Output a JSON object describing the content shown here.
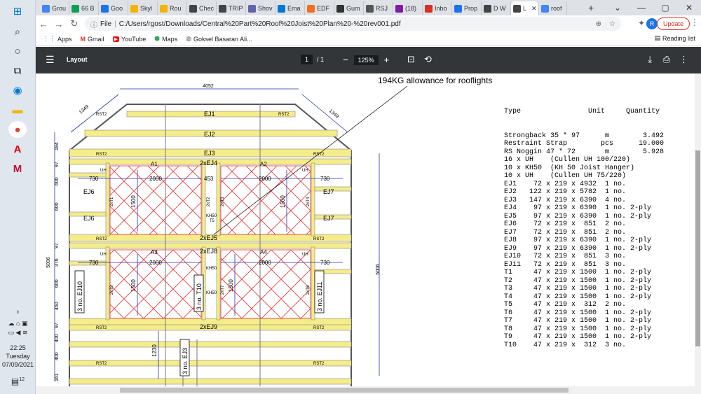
{
  "taskbar": {
    "time": "22:25",
    "day": "Tuesday",
    "date": "07/09/2021",
    "notification_count": "12"
  },
  "tabs": [
    {
      "label": "Grou",
      "color": "#4285f4"
    },
    {
      "label": "66 B",
      "color": "#0f9d58"
    },
    {
      "label": "Goo",
      "color": "#1a73e8"
    },
    {
      "label": "Skyl",
      "color": "#f4b400"
    },
    {
      "label": "Rou",
      "color": "#f4b400"
    },
    {
      "label": "Chec",
      "color": "#444"
    },
    {
      "label": "TRIP",
      "color": "#444"
    },
    {
      "label": "Shov",
      "color": "#6264a7"
    },
    {
      "label": "Ema",
      "color": "#0078d4"
    },
    {
      "label": "EDF",
      "color": "#f37021"
    },
    {
      "label": "Gum",
      "color": "#333"
    },
    {
      "label": "RSJ",
      "color": "#555"
    },
    {
      "label": "(18)",
      "color": "#7b1fa2"
    },
    {
      "label": "Inbo",
      "color": "#d93025"
    },
    {
      "label": "Prop",
      "color": "#1a73e8"
    },
    {
      "label": "D W",
      "color": "#444"
    },
    {
      "label": "L",
      "color": "#444"
    },
    {
      "label": "roof",
      "color": "#4285f4"
    }
  ],
  "url": "C:/Users/rgost/Downloads/Central%20Part%20Roof%20Joist%20Plan%20-%20rev001.pdf",
  "url_prefix": "File",
  "update_label": "Update",
  "profile_initial": "R",
  "bookmarks": [
    "Apps",
    "Gmail",
    "YouTube",
    "Maps",
    "Goksel Basaran Ali..."
  ],
  "reading_list": "Reading list",
  "pdf": {
    "title": "Layout",
    "page_current": "1",
    "page_total": "/ 1",
    "zoom": "125%"
  },
  "annotation": "194KG allowance for rooflights",
  "schedule": {
    "header": "Type                Unit     Quantity",
    "rows": [
      "Strongback 35 * 97      m        3.492",
      "Restraint Strap        pcs      19.000",
      "RS Noggin 47 * 72       m        5.928",
      "16 x UH    (Cullen UH 100/220)",
      "10 x KH50  (KH 50 Joist Hanger)",
      "10 x UH    (Cullen UH 75/220)",
      "EJ1    72 x 219 x 4932  1 no.",
      "EJ2   122 x 219 x 5782  1 no.",
      "EJ3   147 x 219 x 6390  4 no.",
      "EJ4    97 x 219 x 6390  1 no. 2-ply",
      "EJ5    97 x 219 x 6390  1 no. 2-ply",
      "EJ6    72 x 219 x  851  2 no.",
      "EJ7    72 x 219 x  851  2 no.",
      "EJ8    97 x 219 x 6390  1 no. 2-ply",
      "EJ9    97 x 219 x 6390  1 no. 2-ply",
      "EJ10   72 x 219 x  851  3 no.",
      "EJ11   72 x 219 x  851  3 no.",
      "T1     47 x 219 x 1500  1 no. 2-ply",
      "T2     47 x 219 x 1500  1 no. 2-ply",
      "T3     47 x 219 x 1500  1 no. 2-ply",
      "T4     47 x 219 x 1500  1 no. 2-ply",
      "T5     47 x 219 x  312  2 no.",
      "T6     47 x 219 x 1500  1 no. 2-ply",
      "T7     47 x 219 x 1500  1 no. 2-ply",
      "T8     47 x 219 x 1500  1 no. 2-ply",
      "T9     47 x 219 x 1500  1 no. 2-ply",
      "T10    47 x 219 x  312  3 no."
    ]
  },
  "drawing": {
    "top_width": "4052",
    "height_right": "5006",
    "height_left": "5006",
    "diag_left": "1349",
    "diag_right": "1349",
    "labels": {
      "ej1": "EJ1",
      "ej2": "EJ2",
      "ej3": "EJ3",
      "ej4": "2xEJ4",
      "ej5": "2xEJ5",
      "ej6a": "EJ6",
      "ej6b": "EJ6",
      "ej7a": "EJ7",
      "ej7b": "EJ7",
      "ej8": "2xEJ8",
      "ej9": "2xEJ9",
      "ej10": "3 no. EJ10",
      "ej11": "3 no. EJ11",
      "ej3b": "3 no. EJ3",
      "t10": "3 no. T10",
      "a1": "A1",
      "a2": "A2",
      "a3": "A3",
      "a4": "A4",
      "rst": "RST2",
      "uh": "UH",
      "kh": "KH50",
      "t1": "2xT1",
      "t2": "2xT2",
      "t3": "2xT3",
      "t4": "2xT4",
      "t6": "2xT6",
      "t7": "2xT7",
      "t8": "2xT8",
      "t9": "2xT9",
      "t5": "T5",
      "d730a": "730",
      "d730b": "730",
      "d730c": "730",
      "d730d": "730",
      "d2000a": "2000",
      "d2000b": "2000",
      "d2000c": "2000",
      "d2000d": "2000",
      "d453": "453",
      "d1500a": "1500",
      "d1500b": "1500",
      "d1500c": "1500",
      "d1500d": "1500",
      "d1230": "1230",
      "v184": "184",
      "v97a": "97",
      "v600a": "600",
      "v600b": "600",
      "v97b": "97",
      "v376": "376",
      "v600c": "600",
      "v450": "450",
      "v97c": "97",
      "v400a": "400",
      "v400b": "400",
      "v161": "161"
    }
  }
}
